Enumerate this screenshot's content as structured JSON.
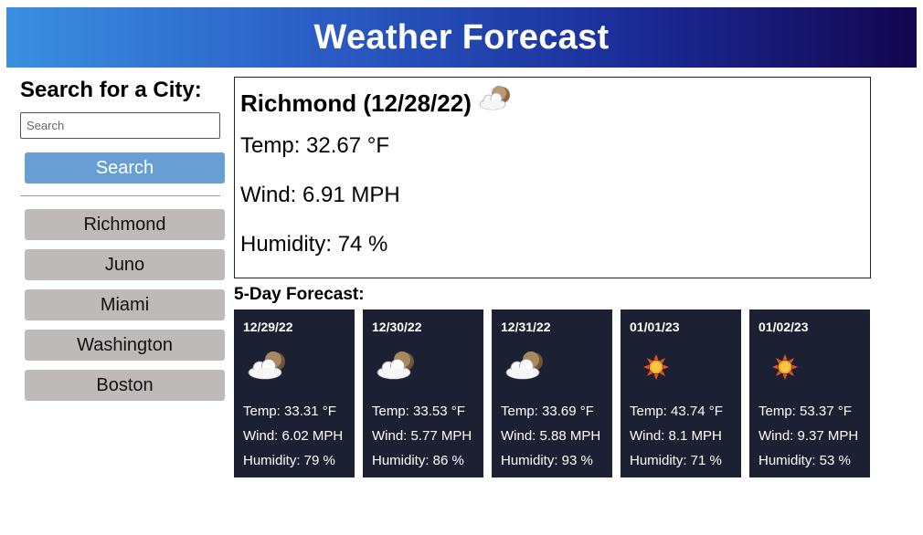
{
  "header": {
    "title": "Weather Forecast"
  },
  "sidebar": {
    "heading": "Search for a City:",
    "search_placeholder": "Search",
    "search_value": "",
    "search_button": "Search",
    "history": [
      {
        "label": "Richmond"
      },
      {
        "label": "Juno"
      },
      {
        "label": "Miami"
      },
      {
        "label": "Washington"
      },
      {
        "label": "Boston"
      }
    ]
  },
  "current": {
    "title": "Richmond (12/28/22)",
    "icon": "partly-cloudy-night-icon",
    "temp": "Temp: 32.67 °F",
    "wind": "Wind: 6.91 MPH",
    "humidity": "Humidity: 74 %"
  },
  "forecast": {
    "heading": "5-Day Forecast:",
    "days": [
      {
        "date": "12/29/22",
        "icon": "partly-cloudy-night-icon",
        "temp": "Temp: 33.31 °F",
        "wind": "Wind: 6.02 MPH",
        "humidity": "Humidity: 79 %"
      },
      {
        "date": "12/30/22",
        "icon": "partly-cloudy-night-icon",
        "temp": "Temp: 33.53 °F",
        "wind": "Wind: 5.77 MPH",
        "humidity": "Humidity: 86 %"
      },
      {
        "date": "12/31/22",
        "icon": "partly-cloudy-night-icon",
        "temp": "Temp: 33.69 °F",
        "wind": "Wind: 5.88 MPH",
        "humidity": "Humidity: 93 %"
      },
      {
        "date": "01/01/23",
        "icon": "sun-icon",
        "temp": "Temp: 43.74 °F",
        "wind": "Wind: 8.1 MPH",
        "humidity": "Humidity: 71 %"
      },
      {
        "date": "01/02/23",
        "icon": "sun-icon",
        "temp": "Temp: 53.37 °F",
        "wind": "Wind: 9.37 MPH",
        "humidity": "Humidity: 53 %"
      }
    ]
  },
  "colors": {
    "header_gradient_start": "#3a8fe0",
    "header_gradient_end": "#14054f",
    "search_button": "#679fd4",
    "history_button": "#bdbab9",
    "card_bg": "#1c2033"
  }
}
